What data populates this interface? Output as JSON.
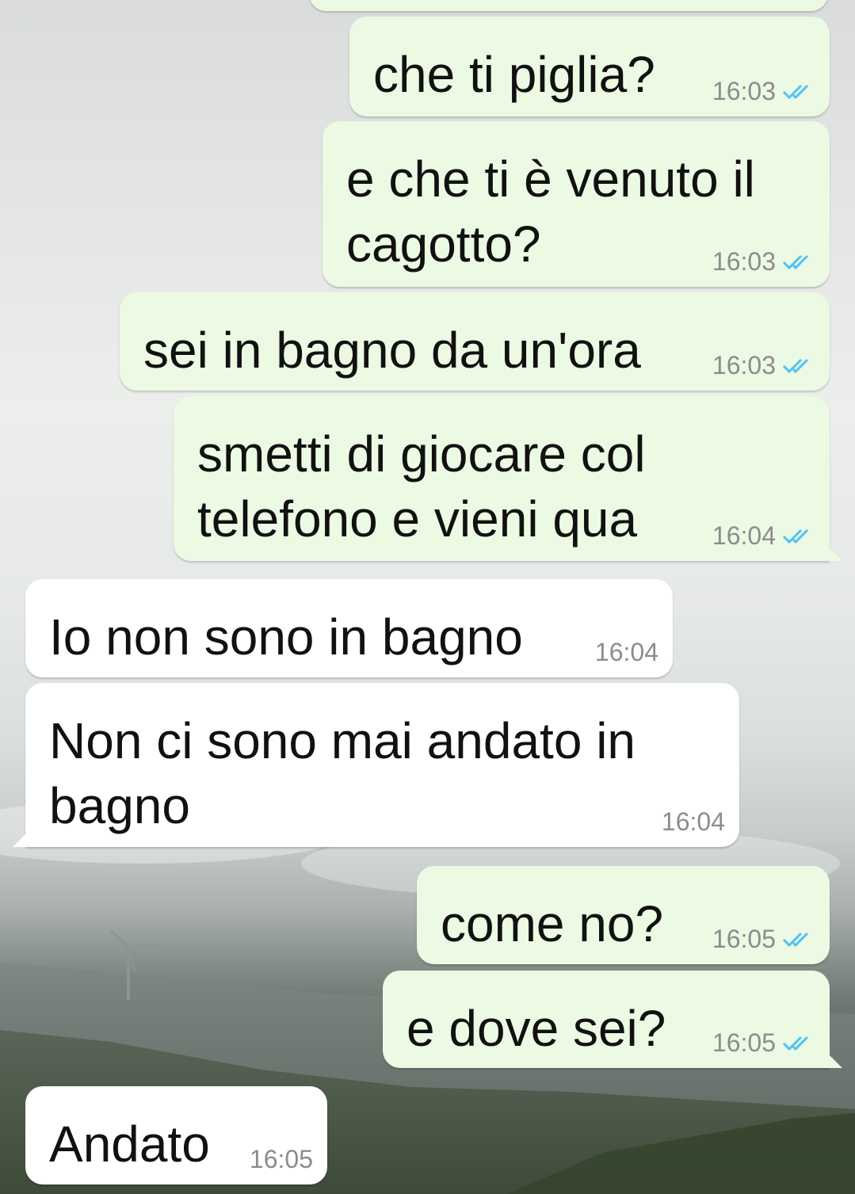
{
  "theme": {
    "outgoing_bubble": "#ecf9e3",
    "incoming_bubble": "#ffffff",
    "read_check_color": "#4fc3f7",
    "meta_text_color": "#8c8c8c"
  },
  "messages": [
    {
      "direction": "out",
      "text": "che ti piglia?",
      "time": "16:03",
      "status": "read-double-check-icon"
    },
    {
      "direction": "out",
      "text": "e che ti è venuto il cagotto?",
      "time": "16:03",
      "status": "read-double-check-icon"
    },
    {
      "direction": "out",
      "text": "sei in bagno da un'ora",
      "time": "16:03",
      "status": "read-double-check-icon"
    },
    {
      "direction": "out",
      "text": "smetti di giocare col telefono e vieni qua",
      "time": "16:04",
      "status": "read-double-check-icon"
    },
    {
      "direction": "in",
      "text": "Io non sono in bagno",
      "time": "16:04"
    },
    {
      "direction": "in",
      "text": "Non ci sono mai andato in bagno",
      "time": "16:04"
    },
    {
      "direction": "out",
      "text": "come no?",
      "time": "16:05",
      "status": "read-double-check-icon"
    },
    {
      "direction": "out",
      "text": "e dove sei?",
      "time": "16:05",
      "status": "read-double-check-icon"
    },
    {
      "direction": "in",
      "text": "Andato",
      "time": "16:05"
    }
  ]
}
